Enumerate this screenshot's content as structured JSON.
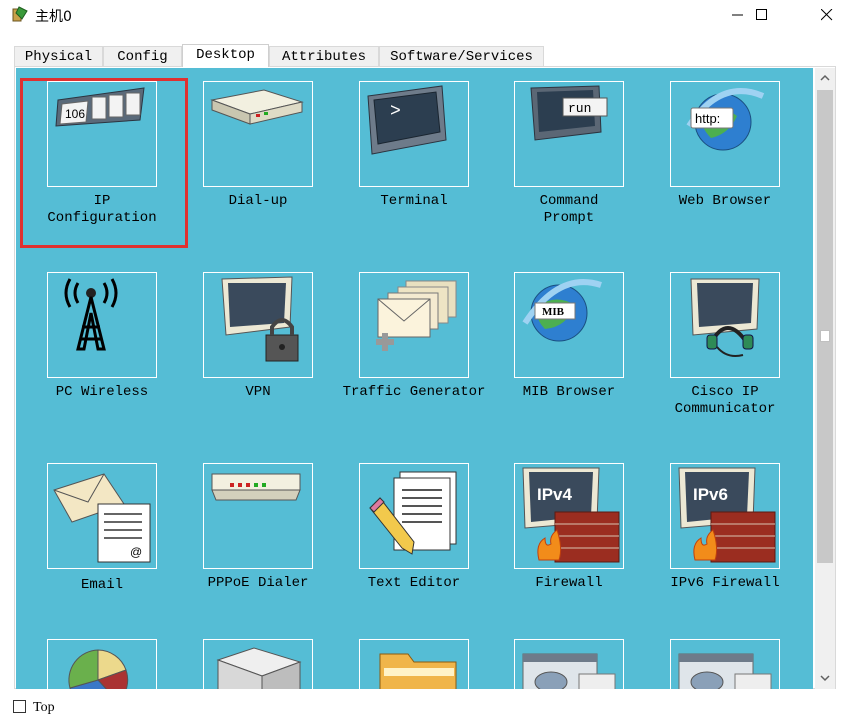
{
  "window": {
    "title": "主机0",
    "icon": "pc-tree-icon",
    "controls": [
      "minimize-icon",
      "maximize-icon",
      "close-icon"
    ]
  },
  "tabs": [
    {
      "label": "Physical",
      "active": false
    },
    {
      "label": "Config",
      "active": false
    },
    {
      "label": "Desktop",
      "active": true
    },
    {
      "label": "Attributes",
      "active": false
    },
    {
      "label": "Software/Services",
      "active": false
    }
  ],
  "desktop": {
    "background_color": "#55bdd5",
    "highlight_color": "#e03030",
    "highlighted_app": "IP\nConfiguration",
    "apps": [
      {
        "label": "IP\nConfiguration",
        "icon": "ip-configuration-icon",
        "icon_text": "106"
      },
      {
        "label": "Dial-up",
        "icon": "dial-up-modem-icon"
      },
      {
        "label": "Terminal",
        "icon": "terminal-icon",
        "icon_text": ">"
      },
      {
        "label": "Command\nPrompt",
        "icon": "command-prompt-icon",
        "icon_text": "run"
      },
      {
        "label": "Web Browser",
        "icon": "web-browser-icon",
        "icon_text": "http:"
      },
      {
        "label": "PC Wireless",
        "icon": "wireless-tower-icon"
      },
      {
        "label": "VPN",
        "icon": "vpn-lock-icon"
      },
      {
        "label": "Traffic Generator",
        "icon": "traffic-generator-icon"
      },
      {
        "label": "MIB Browser",
        "icon": "mib-browser-icon",
        "icon_text": "MIB"
      },
      {
        "label": "Cisco IP\nCommunicator",
        "icon": "ip-communicator-headset-icon"
      },
      {
        "label": "Email",
        "icon": "email-icon",
        "icon_text": "@"
      },
      {
        "label": "PPPoE Dialer",
        "icon": "pppoe-dialer-icon"
      },
      {
        "label": "Text Editor",
        "icon": "text-editor-icon"
      },
      {
        "label": "Firewall",
        "icon": "firewall-icon",
        "icon_text": "IPv4"
      },
      {
        "label": "IPv6 Firewall",
        "icon": "ipv6-firewall-icon",
        "icon_text": "IPv6"
      },
      {
        "label": "",
        "icon": "pie-chart-app-icon"
      },
      {
        "label": "",
        "icon": "sdk-box-icon"
      },
      {
        "label": "",
        "icon": "folder-icon"
      },
      {
        "label": "",
        "icon": "cloud-window-icon"
      },
      {
        "label": "",
        "icon": "cloud-window-icon"
      }
    ]
  },
  "scrollbar": {
    "position": "top",
    "icons": [
      "scroll-up-icon",
      "scroll-down-icon"
    ]
  },
  "footer": {
    "checkbox_checked": false,
    "top_label": "Top"
  }
}
